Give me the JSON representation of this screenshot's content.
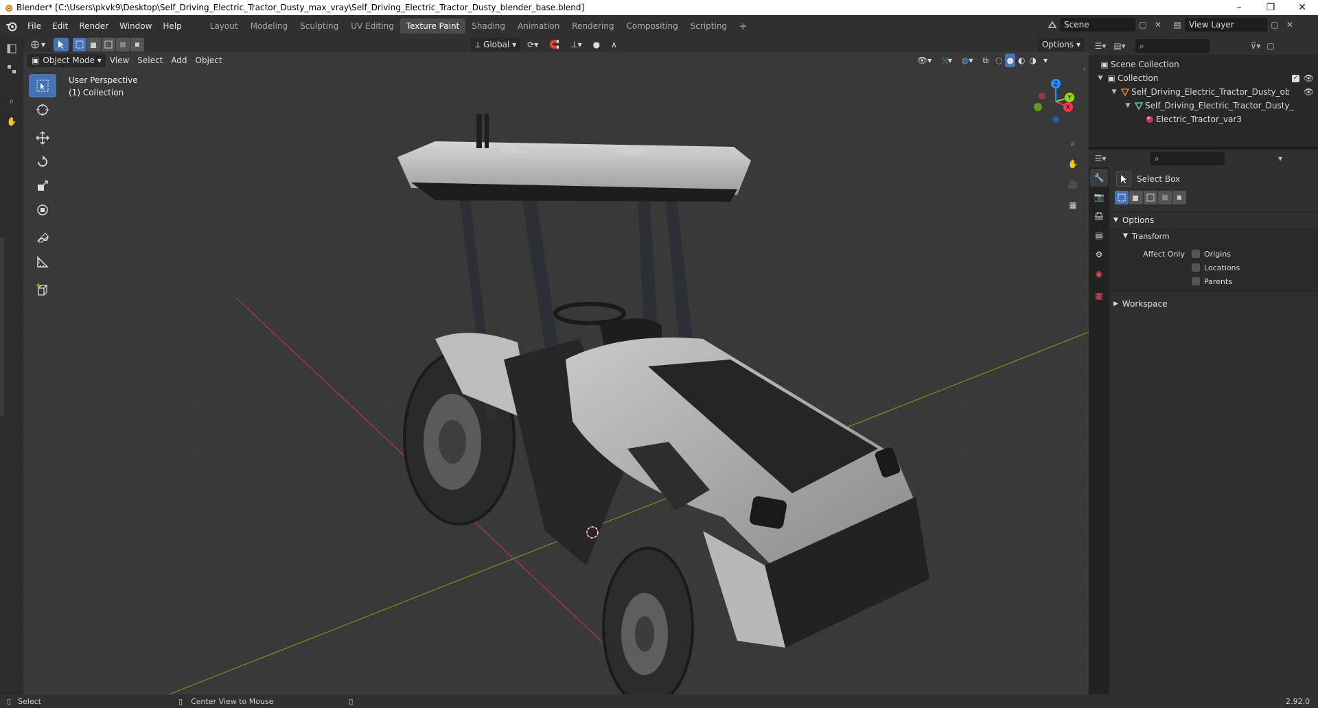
{
  "window": {
    "title": "Blender* [C:\\Users\\pkvk9\\Desktop\\Self_Driving_Electric_Tractor_Dusty_max_vray\\Self_Driving_Electric_Tractor_Dusty_blender_base.blend]",
    "minimize": "–",
    "maximize": "❐",
    "close": "✕"
  },
  "menu": {
    "file": "File",
    "edit": "Edit",
    "render": "Render",
    "window": "Window",
    "help": "Help"
  },
  "workspaces": [
    "Layout",
    "Modeling",
    "Sculpting",
    "UV Editing",
    "Texture Paint",
    "Shading",
    "Animation",
    "Rendering",
    "Compositing",
    "Scripting"
  ],
  "active_workspace": "Texture Paint",
  "scene": {
    "name": "Scene",
    "view_layer": "View Layer"
  },
  "viewport_header": {
    "orientation": "Global",
    "options": "Options",
    "mode": "Object Mode",
    "view": "View",
    "select": "Select",
    "add": "Add",
    "object": "Object"
  },
  "viewport": {
    "perspective": "User Perspective",
    "collection": "(1) Collection"
  },
  "outliner": {
    "root": "Scene Collection",
    "items": [
      {
        "label": "Collection",
        "level": 1
      },
      {
        "label": "Self_Driving_Electric_Tractor_Dusty_obj",
        "level": 2
      },
      {
        "label": "Self_Driving_Electric_Tractor_Dusty_",
        "level": 3
      },
      {
        "label": "Electric_Tractor_var3",
        "level": 4
      }
    ]
  },
  "properties": {
    "tool_name": "Select Box",
    "options_panel": "Options",
    "transform_panel": "Transform",
    "affect_only": "Affect Only",
    "origins": "Origins",
    "locations": "Locations",
    "parents": "Parents",
    "workspace_panel": "Workspace"
  },
  "statusbar": {
    "select": "Select",
    "center_view": "Center View to Mouse",
    "version": "2.92.0"
  },
  "colors": {
    "accent": "#4772b3",
    "viewport_bg": "#393939",
    "axis_x": "#ff3352",
    "axis_y": "#8bdc00",
    "axis_z": "#2890ff"
  }
}
